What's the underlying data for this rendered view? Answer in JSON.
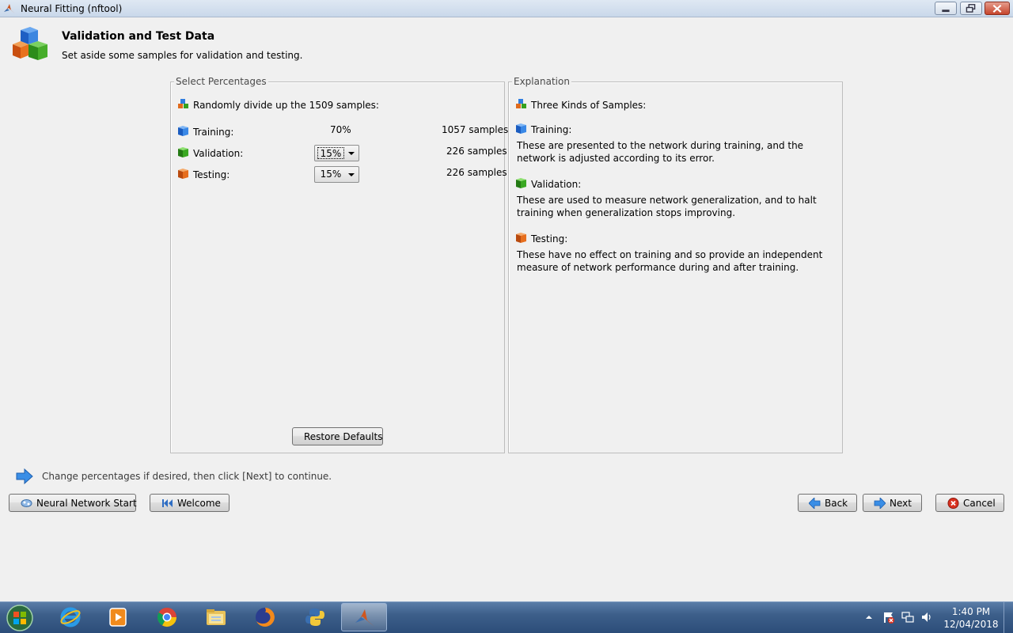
{
  "window": {
    "title": "Neural Fitting (nftool)"
  },
  "header": {
    "title": "Validation and Test Data",
    "subtitle": "Set aside some samples for validation and testing."
  },
  "select_panel": {
    "legend": "Select Percentages",
    "intro": "Randomly divide up the 1509 samples:",
    "rows": [
      {
        "label": "Training:",
        "percent": "70%",
        "samples": "1057 samples",
        "icon": "blue-cube-icon"
      },
      {
        "label": "Validation:",
        "percent": "15%",
        "samples": "226 samples",
        "icon": "green-cube-icon"
      },
      {
        "label": "Testing:",
        "percent": "15%",
        "samples": "226 samples",
        "icon": "orange-cube-icon"
      }
    ],
    "restore_label": "Restore Defaults"
  },
  "explanation_panel": {
    "legend": "Explanation",
    "heading": "Three Kinds of Samples:",
    "items": [
      {
        "title": "Training:",
        "text": "These are presented to the network during training, and the network is adjusted according to its error."
      },
      {
        "title": "Validation:",
        "text": "These are used to measure network generalization, and to halt training when generalization stops improving."
      },
      {
        "title": "Testing:",
        "text": "These have no effect on training and so provide an independent measure of network performance during and after training."
      }
    ]
  },
  "hint": "Change percentages if desired, then click [Next] to continue.",
  "buttons": {
    "nn_start": "Neural Network Start",
    "welcome": "Welcome",
    "back": "Back",
    "next": "Next",
    "cancel": "Cancel"
  },
  "taskbar": {
    "apps": [
      "internet-explorer-icon",
      "media-player-icon",
      "chrome-icon",
      "file-explorer-icon",
      "firefox-icon",
      "python-icon",
      "matlab-icon"
    ],
    "time": "1:40 PM",
    "date": "12/04/2018"
  },
  "colors": {
    "training": "#1e6fd8",
    "validation": "#2e9a1e",
    "testing": "#e0661c",
    "taskbar": "#3d5f8a"
  }
}
